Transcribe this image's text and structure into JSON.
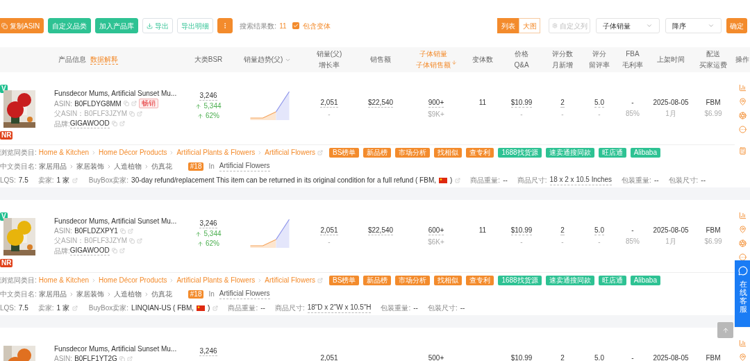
{
  "toolbar": {
    "buttons": [
      {
        "text": "复制ASIN",
        "kind": "copy"
      },
      {
        "text": "自定义品类",
        "kind": "green"
      },
      {
        "text": "加入产品库",
        "kind": "green"
      },
      {
        "text": "导出",
        "kind": "export"
      },
      {
        "text": "导出明细",
        "kind": "outline"
      },
      {
        "kind": "more"
      }
    ],
    "result_label": "搜索结果数:",
    "result_count": "11",
    "include_variants": {
      "label": "包含变体",
      "checked": true
    },
    "views": [
      {
        "text": "列表",
        "selected": true
      },
      {
        "text": "大图",
        "selected": false
      }
    ],
    "custom_columns": {
      "text": "自定义列",
      "disabled": true
    },
    "selects": [
      {
        "value": "子体销量"
      },
      {
        "value": "降序"
      }
    ],
    "confirm": "确定"
  },
  "columns": [
    {
      "lines": [
        "产品信息"
      ],
      "link": "数据解释",
      "sorted": false,
      "kind": "plain"
    },
    {
      "lines": [
        "大类BSR"
      ],
      "sorted": false,
      "kind": "plain"
    },
    {
      "lines": [
        "销量趋势(父)"
      ],
      "sorted": false,
      "kind": "dropdown"
    },
    {
      "lines": [
        "销量(父)",
        "增长率"
      ],
      "sorted": false,
      "kind": "plain"
    },
    {
      "lines": [
        "销售额"
      ],
      "sorted": false,
      "kind": "plain"
    },
    {
      "lines": [
        "子体销量",
        "子体销售额"
      ],
      "sorted": true,
      "kind": "plain"
    },
    {
      "lines": [
        "变体数"
      ],
      "sorted": false,
      "kind": "plain"
    },
    {
      "lines": [
        "价格",
        "Q&A"
      ],
      "sorted": false,
      "kind": "plain"
    },
    {
      "lines": [
        "评分数",
        "月新增"
      ],
      "sorted": false,
      "kind": "plain"
    },
    {
      "lines": [
        "评分",
        "留评率"
      ],
      "sorted": false,
      "kind": "plain"
    },
    {
      "lines": [
        "FBA",
        "毛利率"
      ],
      "sorted": false,
      "kind": "plain"
    },
    {
      "lines": [
        "上架时间"
      ],
      "sorted": false,
      "kind": "plain"
    },
    {
      "lines": [
        "配送",
        "买家运费"
      ],
      "sorted": false,
      "kind": "plain"
    },
    {
      "lines": [
        "操作"
      ],
      "sorted": false,
      "kind": "plain"
    }
  ],
  "products": [
    {
      "badges": {
        "top": "V",
        "bottom": "NR"
      },
      "image": {
        "kind": "picture"
      },
      "trend": {
        "kind": "picture"
      },
      "title": "Funsdecor Mums, Artificial Sunset Mu...",
      "asin_label": "ASIN:",
      "asin": "B0FLDYG8MM",
      "hot_tag": "畅销",
      "parent_label": "父ASIN：",
      "parent_asin": "B0FLF3JZYM",
      "brand_label": "品牌:",
      "brand": "GIGAWOOD",
      "bsr": {
        "rank": "3,246",
        "change": "5,344",
        "pct": "62%"
      },
      "cells": [
        [
          "2,051",
          "-"
        ],
        [
          "$22,540"
        ],
        [
          "900+",
          "$9K+"
        ],
        [
          "11"
        ],
        [
          "$10.99",
          "-"
        ],
        [
          "2",
          "-"
        ],
        [
          "5.0",
          "-"
        ],
        [
          "-",
          "85%"
        ],
        [
          "2025-08-05",
          "1月"
        ],
        [
          "FBM",
          "$6.99"
        ]
      ],
      "details": {
        "category_label": "浏览同类目:",
        "category_path": [
          "Home & Kitchen",
          "Home Décor Products",
          "Artificial Plants & Flowers",
          "Artificial Flowers"
        ],
        "tags": [
          {
            "text": "BS榜单",
            "color": "#f38b2c"
          },
          {
            "text": "新品榜",
            "color": "#f38b2c"
          },
          {
            "text": "市场分析",
            "color": "#f38b2c"
          },
          {
            "text": "找相似",
            "color": "#f38b2c"
          },
          {
            "text": "查专利",
            "color": "#f38b2c"
          },
          {
            "text": "1688找货源",
            "color": "#2ec293"
          },
          {
            "text": "速卖通搜同款",
            "color": "#2ec293"
          },
          {
            "text": "旺店通",
            "color": "#2ec293"
          },
          {
            "text": "Alibaba",
            "color": "#2ec293"
          }
        ],
        "cn_label": "中文类目名:",
        "cn_path": [
          "家居用品",
          "家居装饰",
          "人造植物",
          "仿真花"
        ],
        "rank": "#18",
        "rank_in": "In",
        "rank_category": "Artificial Flowers",
        "lqs_label": "LQS:",
        "lqs": "7.5",
        "sellers_label": "卖家:",
        "sellers": "1 家",
        "buybox_label": "BuyBox卖家:",
        "buybox": "30-day refund/replacement This item can be returned in its original condition for a full refund ( FBM,",
        "buybox_close": ")",
        "specs": [
          {
            "label": "商品重量:",
            "value": "--"
          },
          {
            "label": "商品尺寸:",
            "value": "18 x 2 x 10.5 Inches"
          },
          {
            "label": "包装重量:",
            "value": "--"
          },
          {
            "label": "包装尺寸:",
            "value": "--"
          }
        ]
      }
    },
    {
      "badges": {
        "top": "V",
        "bottom": "NR"
      },
      "image": {
        "kind": "picture"
      },
      "trend": {
        "kind": "picture"
      },
      "title": "Funsdecor Mums, Artificial Sunset Mu...",
      "asin_label": "ASIN:",
      "asin": "B0FLDZXPY1",
      "parent_label": "父ASIN：",
      "parent_asin": "B0FLF3JZYM",
      "brand_label": "品牌:",
      "brand": "GIGAWOOD",
      "bsr": {
        "rank": "3,246",
        "change": "5,344",
        "pct": "62%"
      },
      "cells": [
        [
          "2,051",
          "-"
        ],
        [
          "$22,540"
        ],
        [
          "600+",
          "$6K+"
        ],
        [
          "11"
        ],
        [
          "$10.99",
          "-"
        ],
        [
          "2",
          "-"
        ],
        [
          "5.0",
          "-"
        ],
        [
          "-",
          "85%"
        ],
        [
          "2025-08-05",
          "1月"
        ],
        [
          "FBM",
          "$6.99"
        ]
      ],
      "details": {
        "category_label": "浏览同类目:",
        "category_path": [
          "Home & Kitchen",
          "Home Décor Products",
          "Artificial Plants & Flowers",
          "Artificial Flowers"
        ],
        "tags": [
          {
            "text": "BS榜单",
            "color": "#f38b2c"
          },
          {
            "text": "新品榜",
            "color": "#f38b2c"
          },
          {
            "text": "市场分析",
            "color": "#f38b2c"
          },
          {
            "text": "找相似",
            "color": "#f38b2c"
          },
          {
            "text": "查专利",
            "color": "#f38b2c"
          },
          {
            "text": "1688找货源",
            "color": "#2ec293"
          },
          {
            "text": "速卖通搜同款",
            "color": "#2ec293"
          },
          {
            "text": "旺店通",
            "color": "#2ec293"
          },
          {
            "text": "Alibaba",
            "color": "#2ec293"
          }
        ],
        "cn_label": "中文类目名:",
        "cn_path": [
          "家居用品",
          "家居装饰",
          "人造植物",
          "仿真花"
        ],
        "rank": "#18",
        "rank_in": "In",
        "rank_category": "Artificial Flowers",
        "lqs_label": "LQS:",
        "lqs": "7.5",
        "sellers_label": "卖家:",
        "sellers": "1 家",
        "buybox_label": "BuyBox卖家:",
        "buybox": "LINQIAN-US ( FBM,",
        "buybox_close": ")",
        "specs": [
          {
            "label": "商品重量:",
            "value": "--"
          },
          {
            "label": "商品尺寸:",
            "value": "18\"D x 2\"W x 10.5\"H"
          },
          {
            "label": "包装重量:",
            "value": "--"
          },
          {
            "label": "包装尺寸:",
            "value": "--"
          }
        ]
      }
    },
    {
      "image": {
        "kind": "picture"
      },
      "title": "Funsdecor Mums, Artificial Sunset Mu...",
      "asin_label": "ASIN:",
      "asin": "B0FLF1YT2G",
      "bsr": {
        "rank": "3,246"
      },
      "cells": [
        [
          "2,051"
        ],
        [],
        [
          "500+"
        ],
        [],
        [
          "$10.99"
        ],
        [
          "2"
        ],
        [
          "5.0"
        ],
        [
          "-"
        ],
        [
          "2025-08-05"
        ],
        [
          "FBM"
        ]
      ]
    }
  ],
  "support": {
    "text": "在线客服"
  }
}
